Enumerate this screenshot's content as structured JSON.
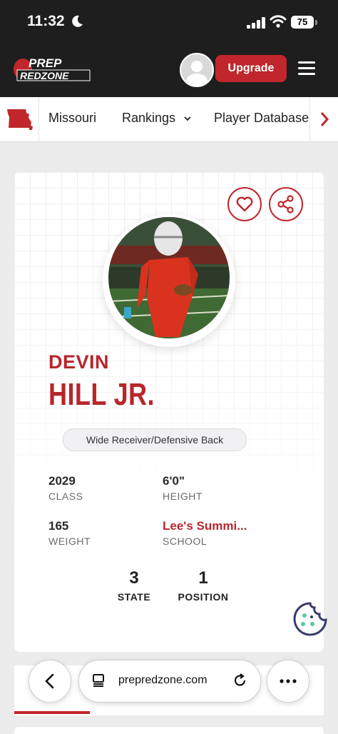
{
  "status_bar": {
    "time": "11:32",
    "battery": "75"
  },
  "header": {
    "upgrade_label": "Upgrade",
    "logo_top": "PREP",
    "logo_bottom": "REDZONE"
  },
  "nav": {
    "items": [
      "Missouri",
      "Rankings",
      "Player Database"
    ]
  },
  "player": {
    "first_name": "DEVIN",
    "last_name": "HILL JR.",
    "position": "Wide Receiver/Defensive Back",
    "stats": [
      {
        "value": "2029",
        "label": "CLASS"
      },
      {
        "value": "6'0\"",
        "label": "HEIGHT"
      },
      {
        "value": "165",
        "label": "WEIGHT"
      },
      {
        "value": "Lee's Summi...",
        "label": "SCHOOL"
      }
    ],
    "ranks": [
      {
        "value": "3",
        "label": "STATE"
      },
      {
        "value": "1",
        "label": "POSITION"
      }
    ]
  },
  "browser": {
    "url": "prepredzone.com"
  },
  "icons": {
    "heart": "heart-icon",
    "share": "share-icon",
    "cookie": "cookie-icon"
  },
  "colors": {
    "brand_red": "#c0262c",
    "dark": "#1e1e1e"
  }
}
